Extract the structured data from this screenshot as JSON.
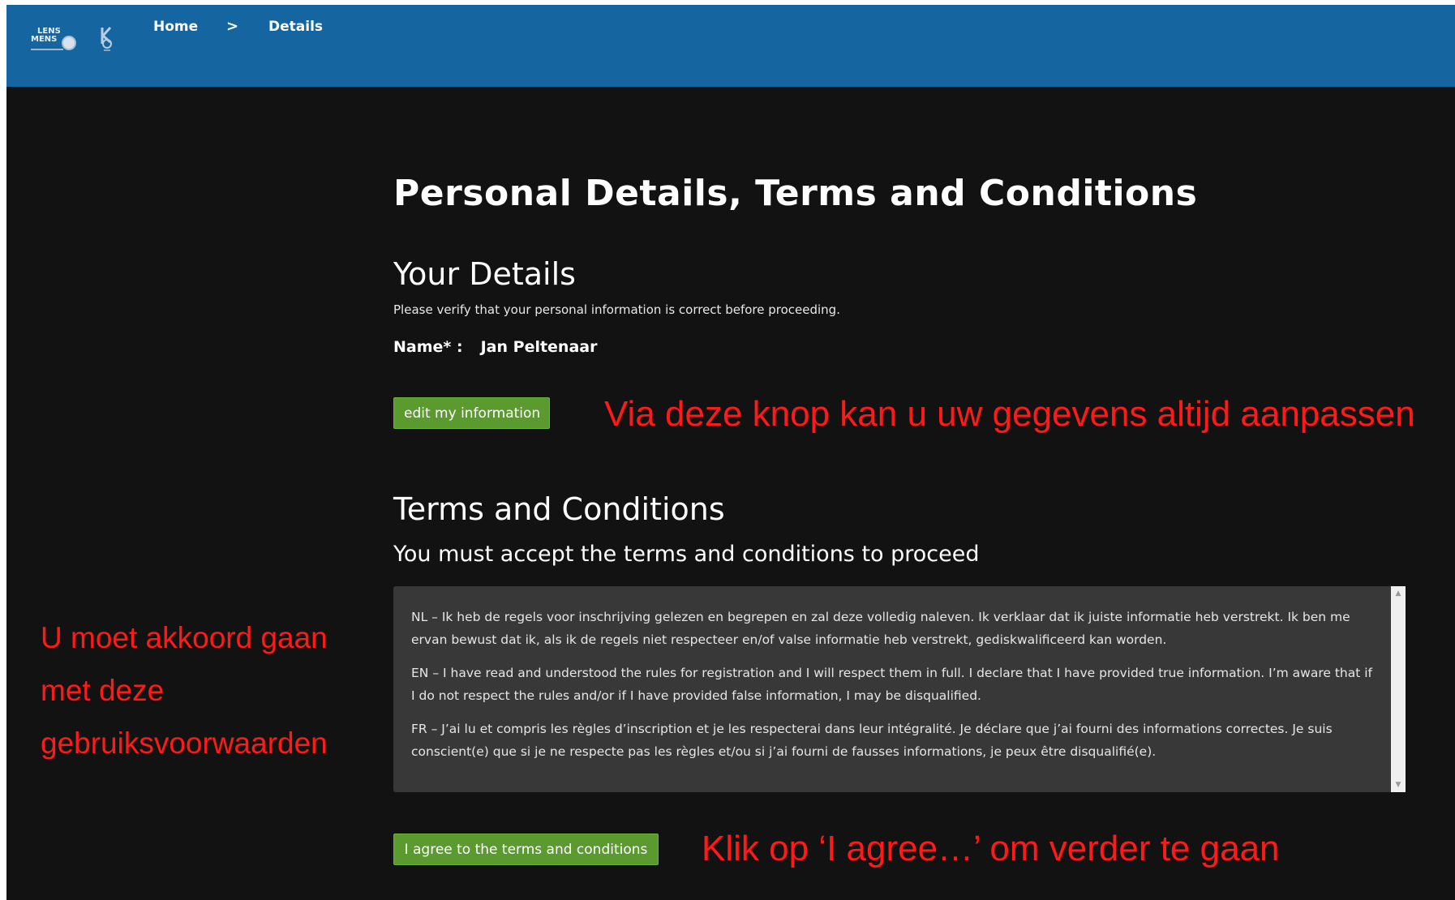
{
  "navbar": {
    "background": "#1566a0",
    "logo_lens": {
      "line1": "LENS",
      "line2": "MENS"
    },
    "logo_icon": "k-logo-icon",
    "breadcrumb": {
      "home": "Home",
      "separator": ">",
      "current": "Details"
    }
  },
  "page": {
    "title": "Personal Details, Terms and Conditions",
    "your_details": {
      "heading": "Your Details",
      "instruction": "Please verify that your personal information is correct before proceeding.",
      "name_label": "Name* :",
      "name_value": "Jan Peltenaar",
      "edit_button": "edit my information"
    },
    "terms": {
      "heading": "Terms and Conditions",
      "subheading": "You must accept the terms and conditions to proceed",
      "paragraphs": [
        "NL – Ik heb de regels voor inschrijving gelezen en begrepen en zal deze volledig naleven. Ik verklaar dat ik juiste informatie heb verstrekt. Ik ben me ervan bewust dat ik, als ik de regels niet respecteer en/of valse informatie heb verstrekt, gediskwalificeerd kan worden.",
        "EN – I have read and understood the rules for registration and I will respect them in full. I declare that I have provided true information. I’m aware that if I do not respect the rules and/or if I have provided false information, I may be disqualified.",
        "FR – J’ai lu et compris les règles d’inscription et je les respecterai dans leur intégralité. Je déclare que j’ai fourni des informations correctes. Je suis conscient(e) que si je ne respecte pas les règles et/ou si j’ai fourni de fausses informations, je peux être disqualifié(e)."
      ],
      "agree_button": "I agree to the terms and conditions"
    }
  },
  "annotations": {
    "color": "#ff1a1a",
    "edit_note": "Via deze knop kan u uw gegevens altijd aanpassen",
    "accept_note_lines": [
      "U moet akkoord gaan",
      "met deze",
      "gebruiksvoorwaarden"
    ],
    "agree_note": "Klik op ‘I agree…’ om verder te gaan"
  },
  "colors": {
    "page_background": "#121212",
    "button_green": "#5a9a2e",
    "terms_box": "#383838"
  }
}
